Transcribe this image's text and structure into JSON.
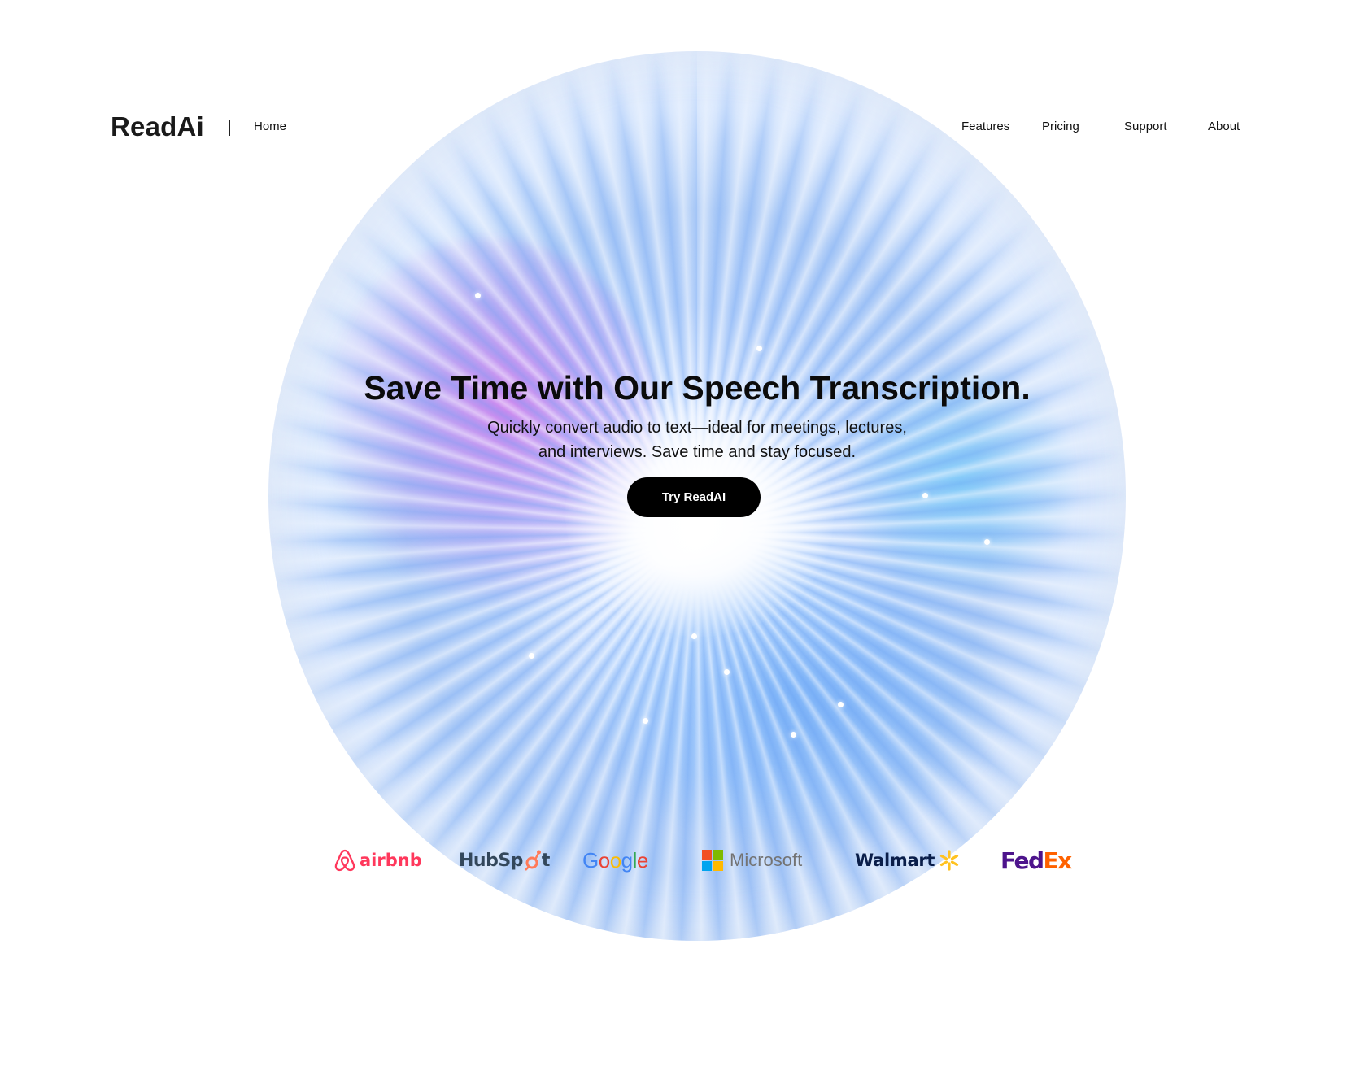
{
  "header": {
    "logo": "ReadAi",
    "nav_left": [
      {
        "label": "Home"
      }
    ],
    "nav_right": [
      {
        "label": "Features"
      },
      {
        "label": "Pricing"
      },
      {
        "label": "Support"
      },
      {
        "label": "About"
      }
    ]
  },
  "hero": {
    "title": "Save Time with Our Speech Transcription.",
    "subtitle_line1": "Quickly convert audio to text—ideal for meetings, lectures,",
    "subtitle_line2": "and interviews. Save time and stay focused.",
    "cta_label": "Try ReadAI",
    "cta_color": "#000000"
  },
  "partners": {
    "airbnb": {
      "text": "airbnb",
      "color": "#ff385c",
      "icon": "airbnb-belo-icon"
    },
    "hubspot": {
      "text_a": "HubSp",
      "text_b": "t",
      "color": "#33475b",
      "accent": "#ff7a59",
      "icon": "hubspot-sprocket-icon"
    },
    "google": {
      "letters": [
        "G",
        "o",
        "o",
        "g",
        "l",
        "e"
      ],
      "colors": [
        "#4285f4",
        "#ea4335",
        "#fbbc05",
        "#4285f4",
        "#34a853",
        "#ea4335"
      ]
    },
    "microsoft": {
      "text": "Microsoft",
      "color": "#737373",
      "icon": "microsoft-squares-icon",
      "square_colors": [
        "#f25022",
        "#7fba00",
        "#00a4ef",
        "#ffb900"
      ]
    },
    "walmart": {
      "text": "Walmart",
      "color": "#0a1e4a",
      "accent": "#ffc220",
      "icon": "walmart-spark-icon"
    },
    "fedex": {
      "text_a": "Fed",
      "text_b": "Ex",
      "color_a": "#4d148c",
      "color_b": "#ff6200"
    }
  }
}
